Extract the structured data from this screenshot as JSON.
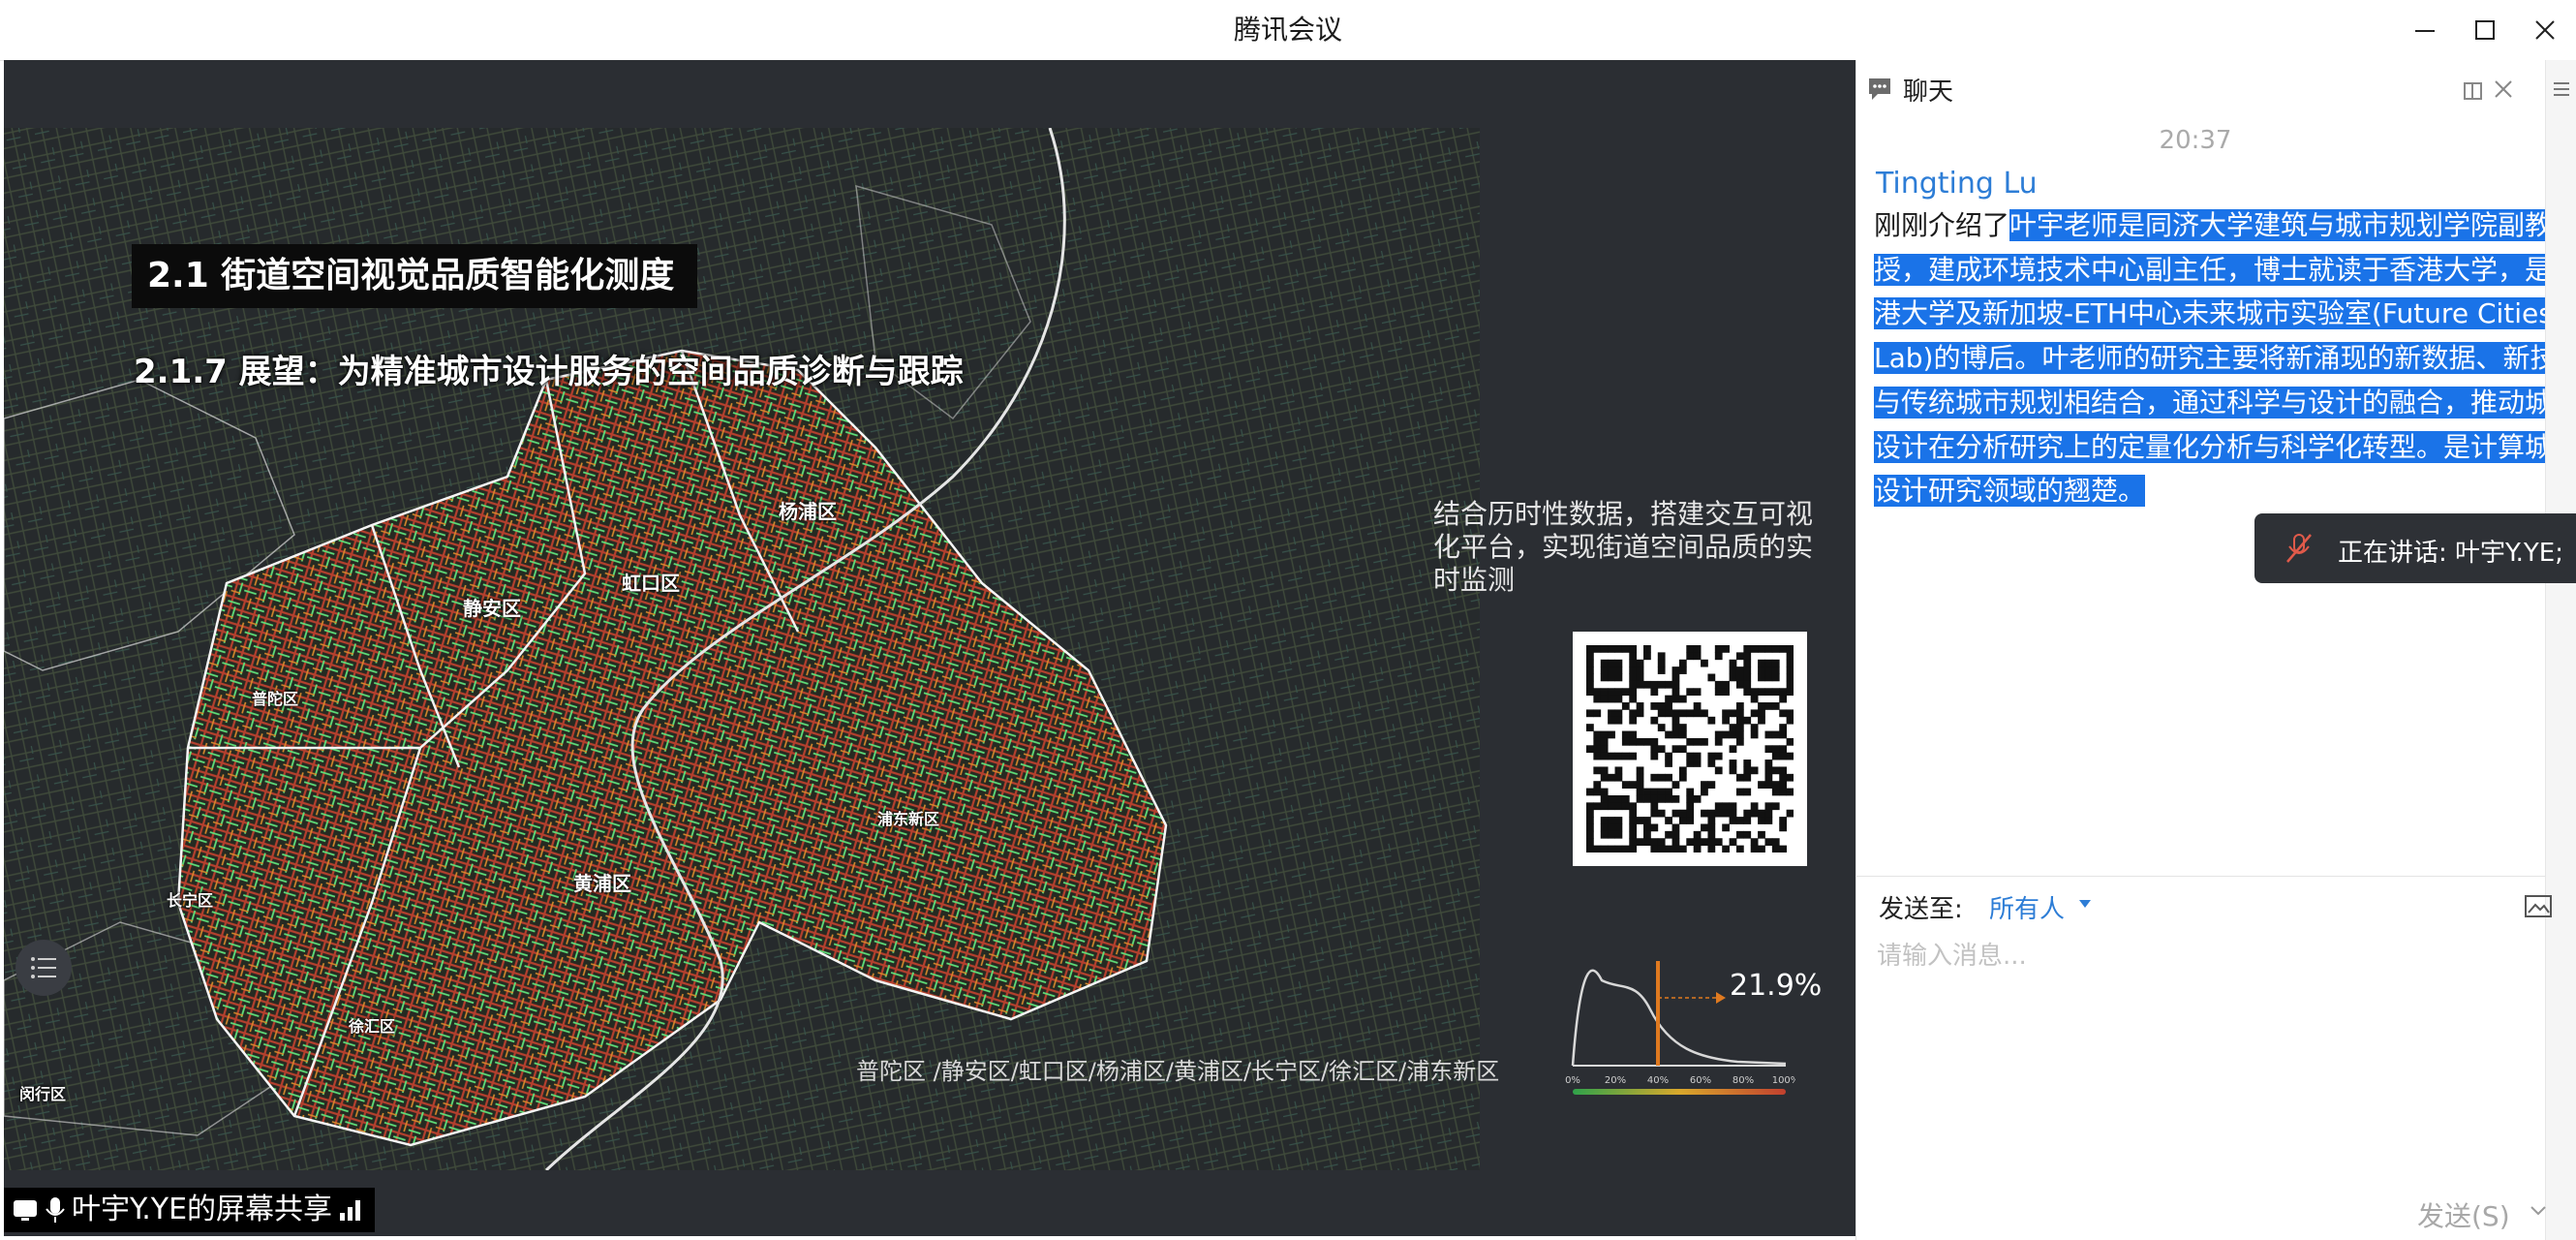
{
  "window": {
    "title": "腾讯会议"
  },
  "slide": {
    "heading": "2.1 街道空间视觉品质智能化测度",
    "subheading": "2.1.7 展望：为精准城市设计服务的空间品质诊断与跟踪",
    "description": "结合历时性数据，搭建交互可视化平台，实现街道空间品质的实时监测",
    "districts": {
      "yangpu": "杨浦区",
      "hongkou": "虹口区",
      "jingan": "静安区",
      "putuo": "普陀区",
      "pudong": "浦东新区",
      "huangpu": "黄浦区",
      "changning": "长宁区",
      "xuhui": "徐汇区",
      "minhang": "闵行区"
    },
    "caption": "普陀区  /静安区/虹口区/杨浦区/黄浦区/长宁区/徐汇区/浦东新区",
    "chart_data": {
      "type": "area",
      "x_ticks": [
        "0%",
        "20%",
        "40%",
        "60%",
        "80%",
        "100%"
      ],
      "marker_x_percent": 40,
      "annotation": "21.9%"
    }
  },
  "share": {
    "label": "叶宇Y.YE的屏幕共享"
  },
  "chat": {
    "title": "聊天",
    "time": "20:37",
    "sender": "Tingting Lu",
    "message_plain": "刚刚介绍了",
    "message_selected": "叶宇老师是同济大学建筑与城市规划学院副教授，建成环境技术中心副主任，博士就读于香港大学，是香港大学及新加坡-ETH中心未来城市实验室(Future Cities Lab)的博后。叶老师的研究主要将新涌现的新数据、新技术与传统城市规划相结合，通过科学与设计的融合，推动城市设计在分析研究上的定量化分析与科学化转型。是计算城市设计研究领域的翘楚。",
    "speaking": "正在讲话: 叶宇Y.YE;",
    "send_to_label": "发送至:",
    "send_to_value": "所有人",
    "input_placeholder": "请输入消息...",
    "send_button": "发送(S)"
  },
  "colors": {
    "stage_bg": "#2b2e33",
    "selection": "#1a73e8",
    "link_blue": "#2d7dd6",
    "street_green": "#5fe07a",
    "street_red": "#b4402e",
    "street_orange": "#d98a2c"
  },
  "icons": [
    "minimize-icon",
    "maximize-icon",
    "close-icon",
    "chat-icon",
    "popout-icon",
    "panel-close-icon",
    "menu-icon",
    "mic-muted-icon",
    "screen-share-icon",
    "mic-icon",
    "signal-icon",
    "toc-list-icon",
    "caret-down-icon",
    "image-icon"
  ]
}
